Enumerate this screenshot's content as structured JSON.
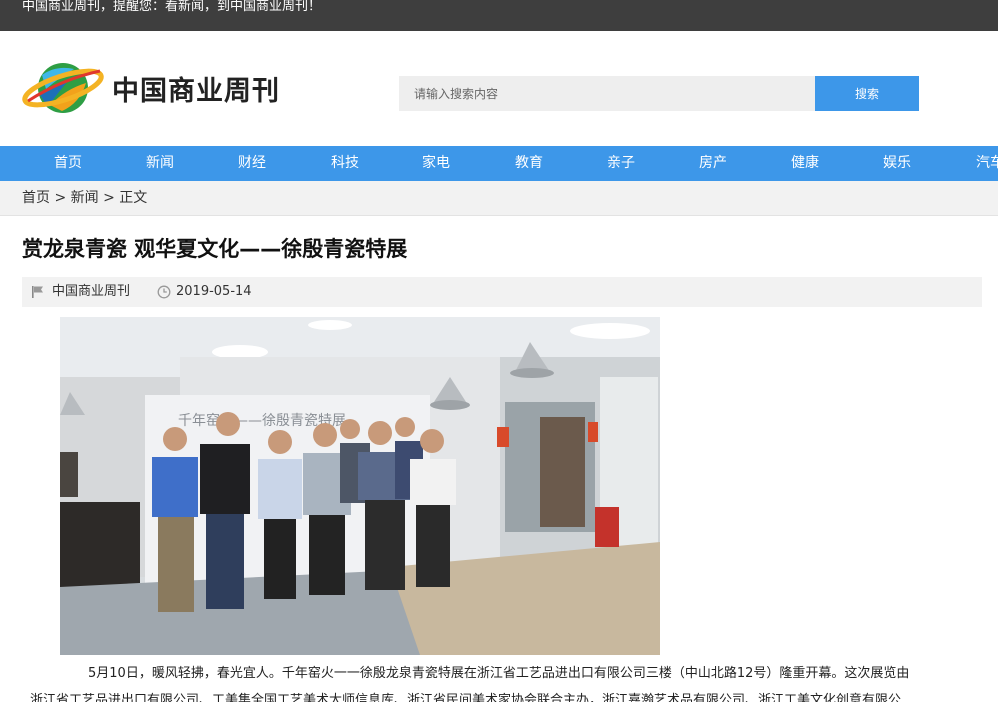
{
  "topbar": {
    "text": "中国商业周刊，提醒您：看新闻，到中国商业周刊！"
  },
  "header": {
    "logo_text": "中国商业周刊",
    "search_placeholder": "请输入搜索内容",
    "search_button": "搜索"
  },
  "nav": {
    "items": [
      "首页",
      "新闻",
      "财经",
      "科技",
      "家电",
      "教育",
      "亲子",
      "房产",
      "健康",
      "娱乐",
      "汽车"
    ]
  },
  "breadcrumb": {
    "home": "首页",
    "sep": " > ",
    "news": "新闻",
    "current": "正文"
  },
  "article": {
    "title": "赏龙泉青瓷 观华夏文化——徐殷青瓷特展",
    "source": "中国商业周刊",
    "date": "2019-05-14",
    "photo_banner_text": "千年窑火——徐殷青瓷特展",
    "paragraph1": "5月10日，暖风轻拂，春光宜人。千年窑火一一徐殷龙泉青瓷特展在浙江省工艺品进出口有限公司三楼（中山北路12号）隆重开幕。这次展览由",
    "paragraph2": "浙江省工艺品进出口有限公司、工美集全国工艺美术大师信息库、浙江省民间美术家协会联合主办，浙江嘉瀚艺术品有限公司、浙江工美文化创意有限公"
  },
  "colors": {
    "accent": "#3d97e9",
    "topbar": "#3e3e3e",
    "light_bg": "#f2f2f2"
  }
}
